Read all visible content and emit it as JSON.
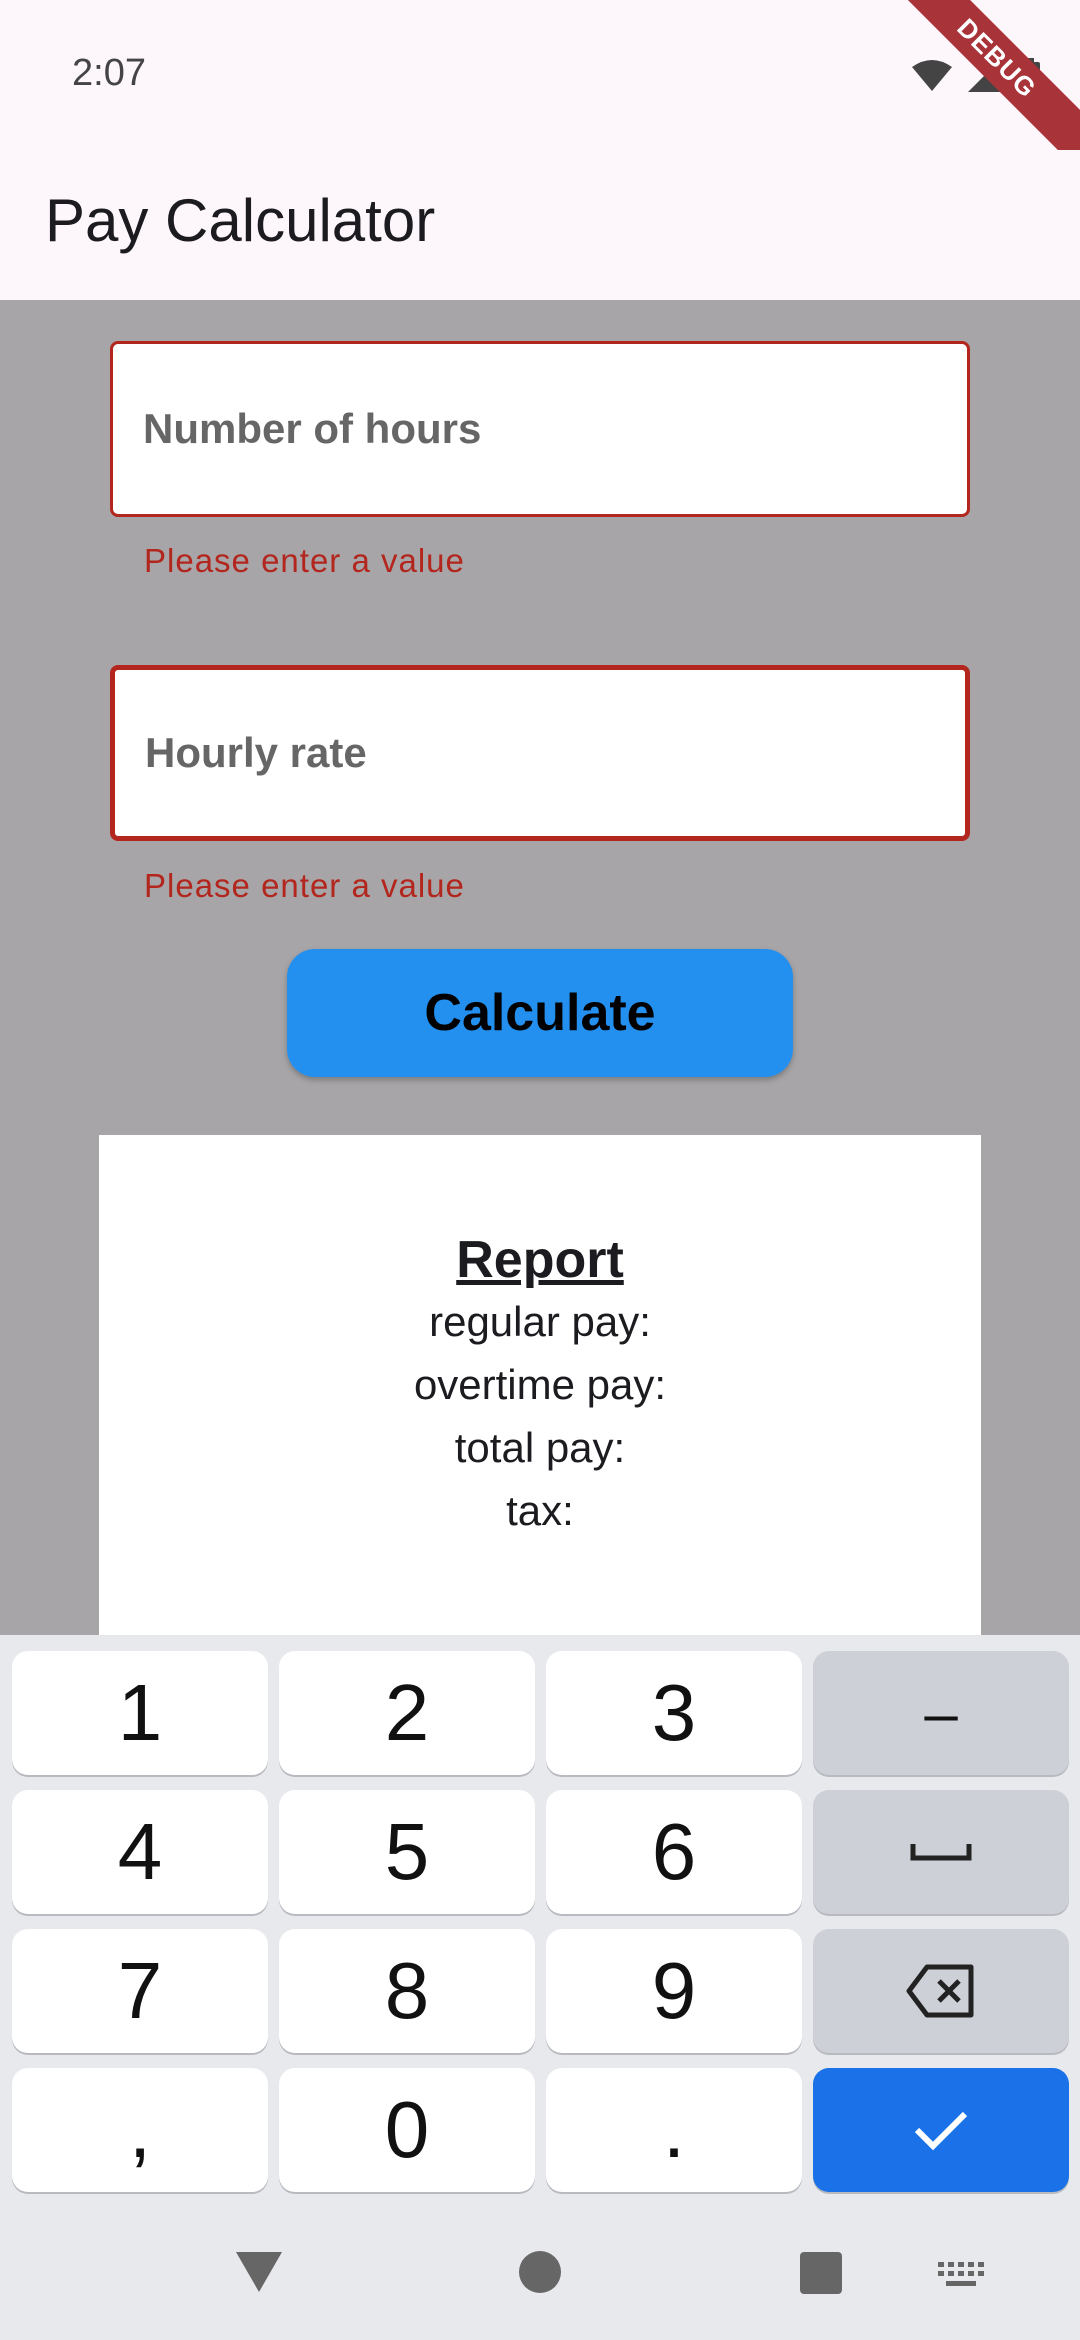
{
  "status": {
    "time": "2:07",
    "debug_label": "DEBUG"
  },
  "app": {
    "title": "Pay Calculator"
  },
  "form": {
    "hours_placeholder": "Number of hours",
    "hours_value": "",
    "hours_error": "Please enter a value",
    "rate_placeholder": "Hourly rate",
    "rate_value": "",
    "rate_error": "Please enter a value",
    "calculate_label": "Calculate"
  },
  "report": {
    "title": "Report",
    "regular_pay": "regular pay:",
    "overtime_pay": "overtime pay:",
    "total_pay": "total pay:",
    "tax": "tax:"
  },
  "keyboard": {
    "keys": [
      "1",
      "2",
      "3",
      "–",
      "4",
      "5",
      "6",
      "",
      "7",
      "8",
      "9",
      "",
      ",",
      "0",
      ".",
      ""
    ]
  },
  "colors": {
    "accent": "#2390ef",
    "error": "#b3261e",
    "keyboard_action": "#1b72e8"
  }
}
